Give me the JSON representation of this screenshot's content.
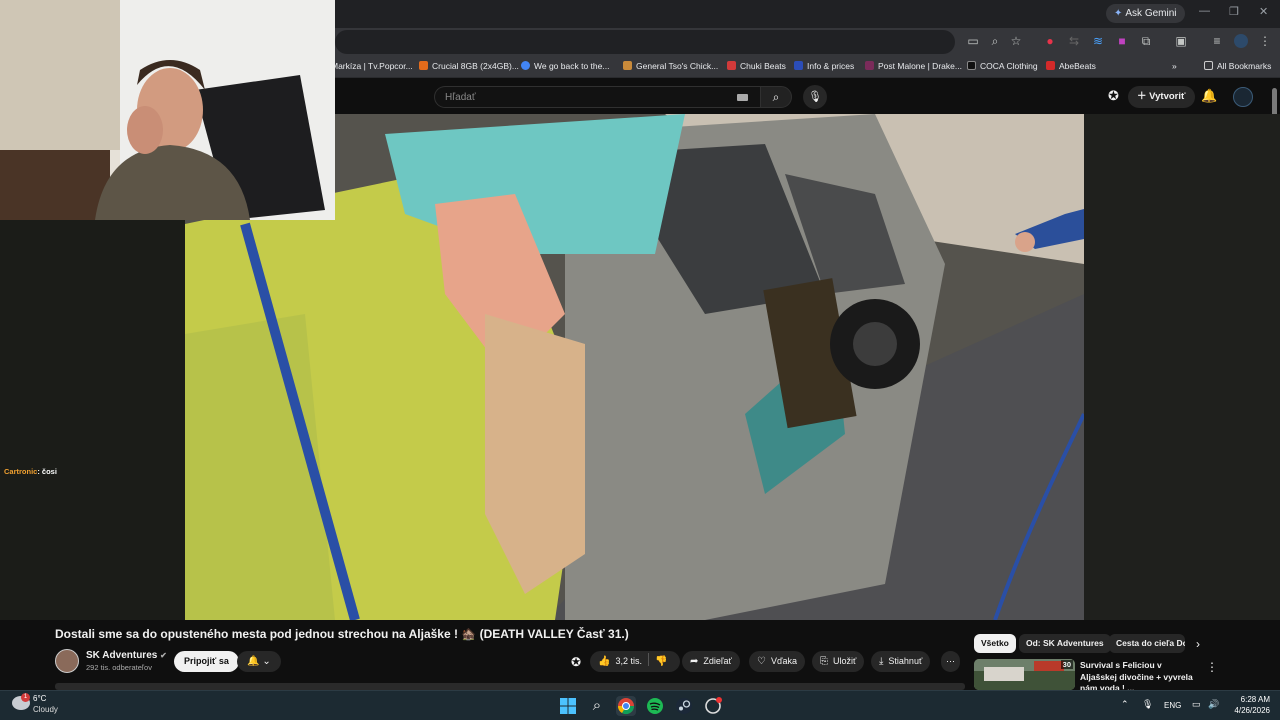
{
  "browser": {
    "ask_gemini": "Ask Gemini",
    "bookmarks": [
      {
        "label": "Markíza | Tv.Popcor...",
        "color": "#5a5a5a"
      },
      {
        "label": "Crucial 8GB (2x4GB)...",
        "color": "#e36b1b"
      },
      {
        "label": "We go back to the...",
        "color": "#4285f4"
      },
      {
        "label": "General Tso's Chick...",
        "color": "#c98a3a"
      },
      {
        "label": "Chuki Beats",
        "color": "#d13a3a"
      },
      {
        "label": "Info & prices",
        "color": "#2b4db8"
      },
      {
        "label": "Post Malone | Drake...",
        "color": "#7a2b5a"
      },
      {
        "label": "COCA Clothing",
        "color": "#333333"
      },
      {
        "label": "AbeBeats",
        "color": "#d42a2a"
      }
    ],
    "all_bookmarks": "All Bookmarks"
  },
  "youtube": {
    "search_placeholder": "Hľadať",
    "create_label": "Vytvoriť",
    "video_title": "Dostali sme sa do opusteného mesta pod jednou strechou na Aljaške ! 🏚️ (DEATH VALLEY Časť 31.)",
    "channel_name": "SK Adventures",
    "subscribers": "292 tis. odberateľov",
    "join_label": "Pripojiť sa",
    "like_count": "3,2 tis.",
    "share_label": "Zdieľať",
    "thanks_label": "Vďaka",
    "save_label": "Uložiť",
    "download_label": "Stiahnuť",
    "chips": [
      "Všetko",
      "Od: SK Adventures",
      "Cesta do cieľa Do"
    ],
    "recommended": {
      "duration": "30",
      "title": "Survival s Feliciou v Aljašskej divočine + vyvrela nám voda ! ..."
    }
  },
  "overlay": {
    "chat_nick": "Cartronic",
    "chat_message": ": čosi"
  },
  "taskbar": {
    "temperature": "6°C",
    "weather": "Cloudy",
    "weather_badge": "1",
    "language": "ENG",
    "time": "6:28 AM",
    "date": "4/26/2026"
  },
  "colors": {
    "accent": "#f1f1f1",
    "background": "#0f0f0f",
    "taskbar": "#1c2a32"
  }
}
